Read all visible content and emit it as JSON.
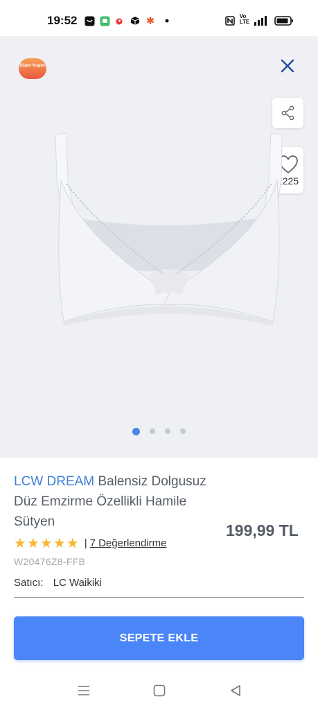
{
  "status_bar": {
    "time": "19:52",
    "right_text": "Vo LTE",
    "icons": [
      "app-notification-icon",
      "message-icon",
      "vodafone-icon",
      "box-icon",
      "asterisk-icon",
      "dot-icon",
      "nfc-icon",
      "signal-icon",
      "battery-icon"
    ]
  },
  "gallery": {
    "coupon_badge": "Süper Kupon",
    "favorite_count": "2225",
    "slide_count": 4,
    "active_slide": 1
  },
  "product": {
    "brand": "LCW DREAM",
    "name": " Balensiz Dolgusuz Düz Emzirme Özellikli Hamile Sütyen",
    "price": "199,99 TL",
    "rating": 5,
    "review_separator": "|",
    "review_link": "7 Değerlendirme",
    "sku": "W20476Z8-FFB",
    "seller_label": "Satıcı:",
    "seller_name": "LC Waikiki"
  },
  "actions": {
    "add_to_cart": "SEPETE EKLE"
  },
  "colors": {
    "accent": "#4a86f7",
    "brand_text": "#3f7fd6",
    "star": "#f7b733",
    "gallery_bg": "#eef0f4"
  }
}
